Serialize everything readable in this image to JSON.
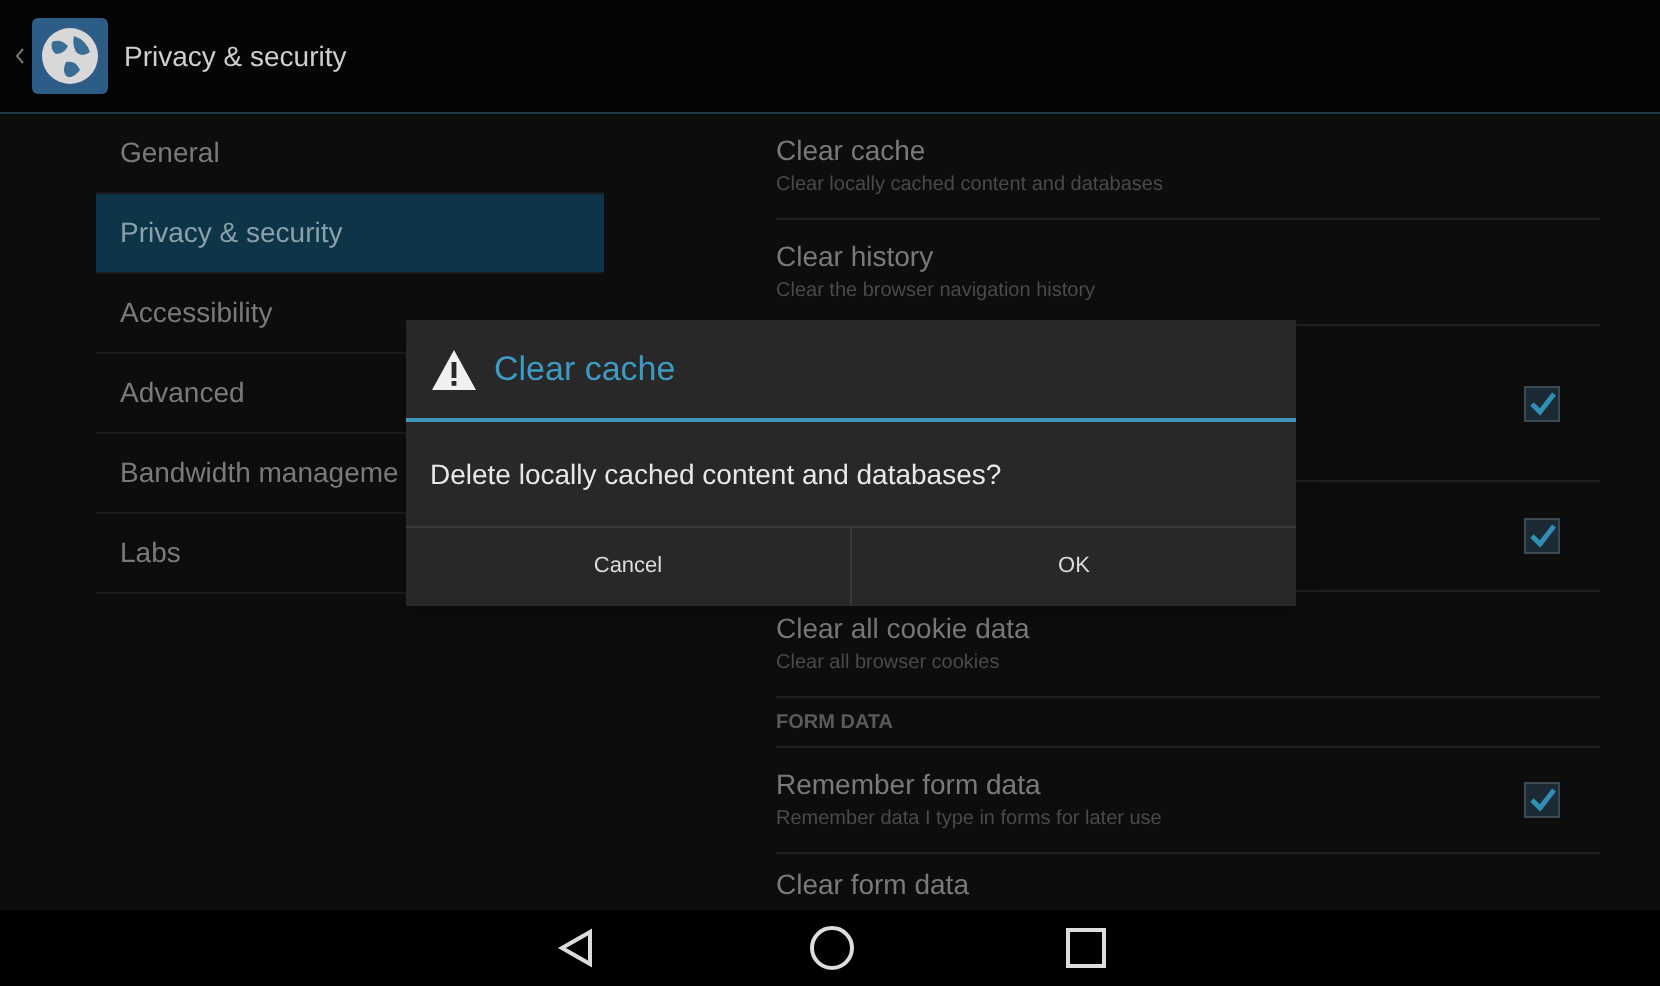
{
  "action_bar": {
    "title": "Privacy & security"
  },
  "sidebar": {
    "items": [
      {
        "label": "General",
        "selected": false
      },
      {
        "label": "Privacy & security",
        "selected": true
      },
      {
        "label": "Accessibility",
        "selected": false
      },
      {
        "label": "Advanced",
        "selected": false
      },
      {
        "label": "Bandwidth manageme",
        "selected": false
      },
      {
        "label": "Labs",
        "selected": false
      }
    ]
  },
  "settings": [
    {
      "kind": "action",
      "title": "Clear cache",
      "summary": "Clear locally cached content and databases"
    },
    {
      "kind": "action",
      "title": "Clear history",
      "summary": "Clear the browser navigation history"
    },
    {
      "kind": "checkbox",
      "checked": true
    },
    {
      "kind": "checkbox",
      "checked": true
    },
    {
      "kind": "action",
      "title": "Clear all cookie data",
      "summary": "Clear all browser cookies"
    },
    {
      "kind": "header",
      "title": "FORM DATA"
    },
    {
      "kind": "checkbox",
      "title": "Remember form data",
      "summary": "Remember data I type in forms for later use",
      "checked": true
    },
    {
      "kind": "action",
      "title": "Clear form data"
    }
  ],
  "dialog": {
    "title": "Clear cache",
    "message": "Delete locally cached content and databases?",
    "buttons": [
      "Cancel",
      "OK"
    ]
  }
}
